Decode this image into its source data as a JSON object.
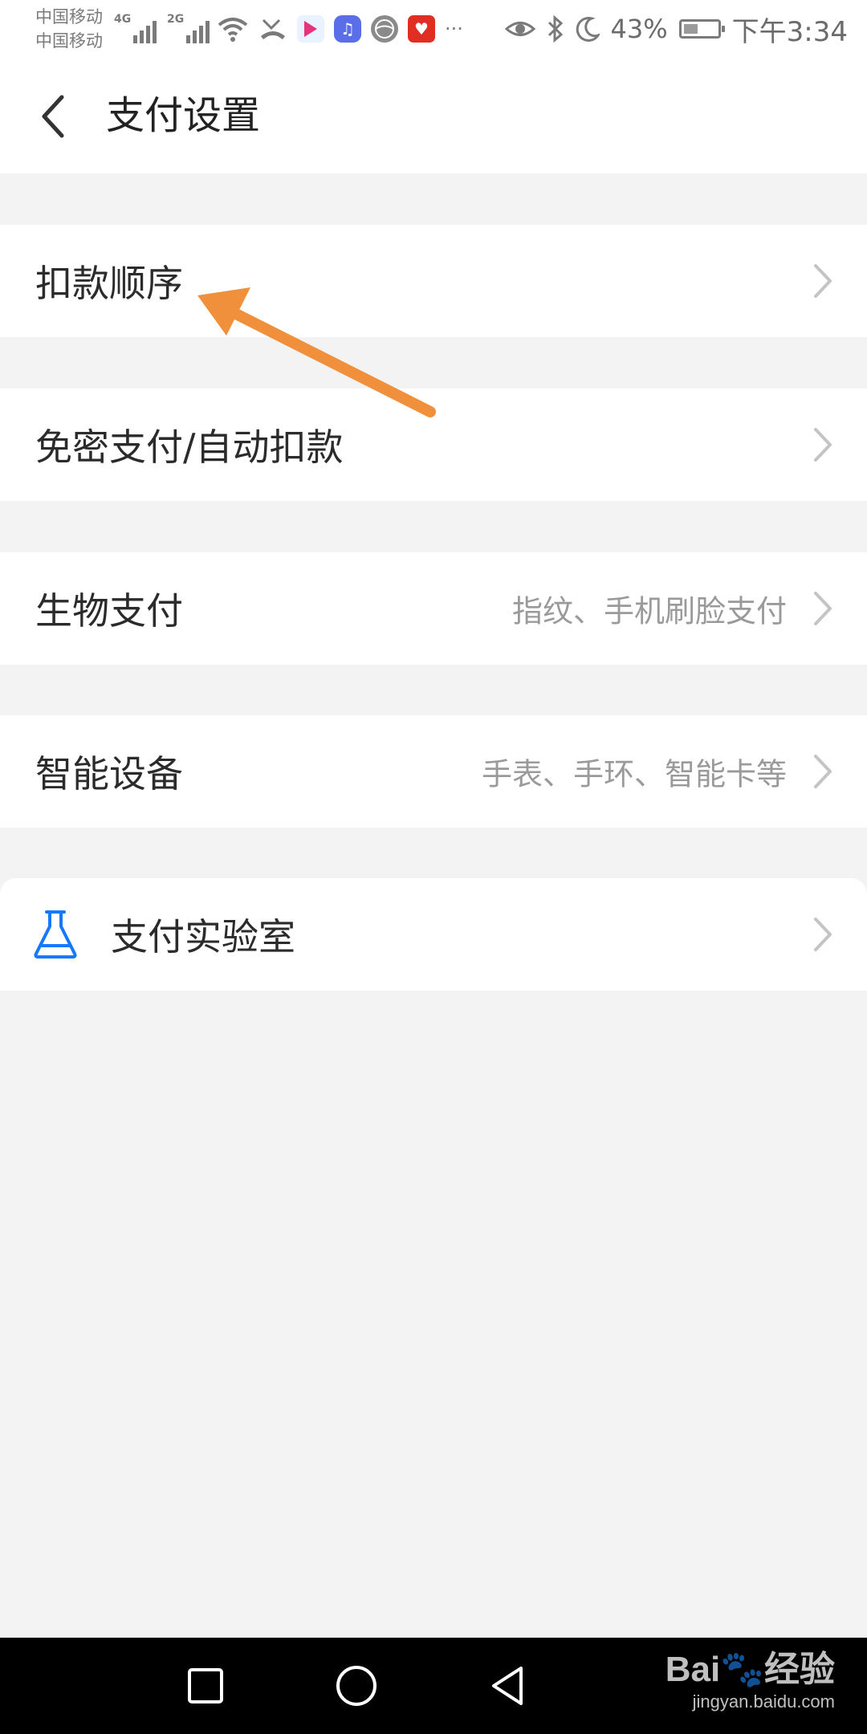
{
  "status_bar": {
    "carrier_1": "中国移动",
    "carrier_2": "中国移动",
    "net_1": "4G",
    "net_2": "2G",
    "more": "···",
    "battery_percent": "43%",
    "battery_level": 0.43,
    "time": "下午3:34",
    "icons": [
      "signal-icon",
      "wifi-icon",
      "missed-call-icon",
      "app-notification-icon",
      "music-icon",
      "ball-icon",
      "heart-app-icon",
      "eye-icon",
      "bluetooth-icon",
      "moon-icon",
      "battery-icon"
    ]
  },
  "header": {
    "title": "支付设置",
    "back_icon": "chevron-left-icon"
  },
  "settings": {
    "items": [
      {
        "label": "扣款顺序",
        "hint": ""
      },
      {
        "label": "免密支付/自动扣款",
        "hint": ""
      },
      {
        "label": "生物支付",
        "hint": "指纹、手机刷脸支付"
      },
      {
        "label": "智能设备",
        "hint": "手表、手环、智能卡等"
      },
      {
        "label": "支付实验室",
        "hint": "",
        "icon": "flask-icon"
      }
    ]
  },
  "nav_bar": {
    "buttons": [
      "recent-apps-icon",
      "home-icon",
      "back-icon"
    ]
  },
  "watermark": {
    "brand": "Bai",
    "brand_suffix": "经验",
    "url": "jingyan.baidu.com"
  },
  "colors": {
    "annotation_arrow": "#f0903c",
    "lab_icon": "#1677ff",
    "background": "#f3f3f3"
  }
}
